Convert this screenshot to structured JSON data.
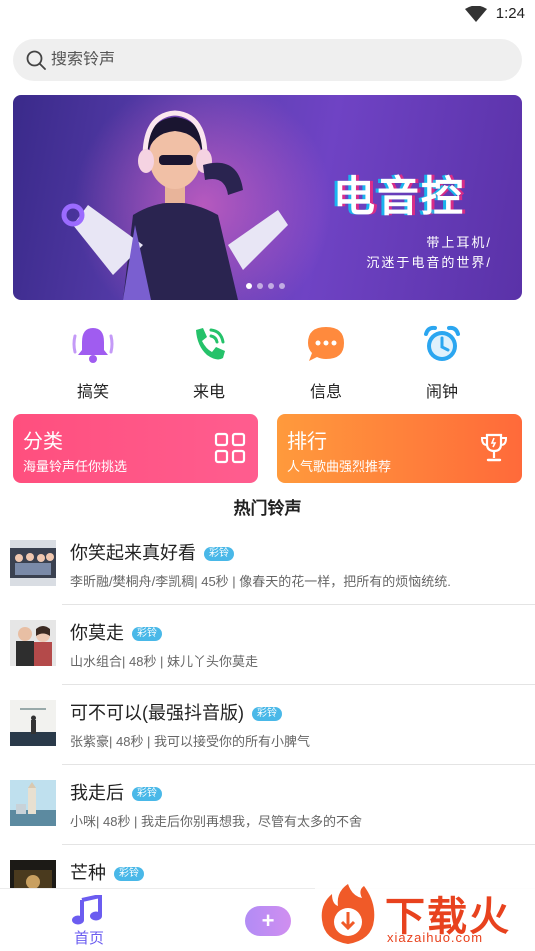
{
  "status_bar": {
    "time": "1:24",
    "wifi_icon": "wifi-icon"
  },
  "search": {
    "placeholder": "搜索铃声",
    "icon": "search-icon"
  },
  "banner": {
    "title": "电音控",
    "line1": "带上耳机/",
    "line2": "沉迷于电音的世界/",
    "page_count": 4,
    "active_page": 1
  },
  "categories": [
    {
      "label": "搞笑",
      "icon": "bell-icon",
      "color": "#a05cf0"
    },
    {
      "label": "来电",
      "icon": "phone-icon",
      "color": "#25c26a"
    },
    {
      "label": "信息",
      "icon": "message-icon",
      "color": "#ff8a3d"
    },
    {
      "label": "闹钟",
      "icon": "alarm-icon",
      "color": "#2ba6f0"
    }
  ],
  "cards": [
    {
      "title": "分类",
      "subtitle": "海量铃声任你挑选",
      "icon": "grid-icon",
      "colors": [
        "#ff4f7e",
        "#ff5d8f"
      ]
    },
    {
      "title": "排行",
      "subtitle": "人气歌曲强烈推荐",
      "icon": "trophy-icon",
      "colors": [
        "#ff9a3c",
        "#ff6a3a"
      ]
    }
  ],
  "section_title": "热门铃声",
  "badge_label": "彩铃",
  "songs": [
    {
      "title": "你笑起来真好看",
      "meta": "李昕融/樊桐舟/李凯稠| 45秒 |    像春天的花一样，把所有的烦恼统统."
    },
    {
      "title": "你莫走",
      "meta": "山水组合| 48秒 |    妹儿丫头你莫走"
    },
    {
      "title": "可不可以(最强抖音版)",
      "meta": "张紫豪| 48秒 |    我可以接受你的所有小脾气"
    },
    {
      "title": "我走后",
      "meta": "小咪| 48秒 |    我走后你别再想我，尽管有太多的不舍"
    },
    {
      "title": "芒种",
      "meta": ""
    }
  ],
  "bottom_nav": {
    "home_label": "首页",
    "home_icon": "music-note-icon",
    "add_icon": "plus-icon",
    "accent": "#6b5cf0"
  },
  "watermark": {
    "text": "下载火",
    "url": "xiazaihuo.com",
    "color": "#e8421e"
  }
}
